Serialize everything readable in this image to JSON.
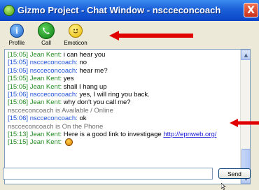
{
  "window": {
    "title": "Gizmo Project - Chat Window - nscceconcoach",
    "close_glyph": "X"
  },
  "toolbar": {
    "items": [
      {
        "label": "Profile",
        "icon": "info-icon",
        "glyph": "i"
      },
      {
        "label": "Call",
        "icon": "phone-icon"
      },
      {
        "label": "Emoticon",
        "icon": "smiley-icon"
      }
    ]
  },
  "chat": {
    "lines": [
      {
        "ts": "[15:05] Jean Kent:",
        "who": "jean",
        "msg": " i can hear you"
      },
      {
        "ts": "[15:05] nscceconcoach:",
        "who": "nsc",
        "msg": " no"
      },
      {
        "ts": "[15:05] nscceconcoach:",
        "who": "nsc",
        "msg": " hear me?"
      },
      {
        "ts": "[15:05] Jean Kent:",
        "who": "jean",
        "msg": " yes"
      },
      {
        "ts": "[15:05] Jean Kent:",
        "who": "jean",
        "msg": " shall I hang up"
      },
      {
        "ts": "[15:06] nscceconcoach:",
        "who": "nsc",
        "msg": " yes, I will ring you back."
      },
      {
        "ts": "[15:06] Jean Kent:",
        "who": "jean",
        "msg": " why don't you call me?"
      },
      {
        "status": "nscceconcoach is Available / Online"
      },
      {
        "ts": "[15:06] nscceconcoach:",
        "who": "nsc",
        "msg": " ok"
      },
      {
        "status": "nscceconcoach is On the Phone"
      },
      {
        "ts": "[15:13] Jean Kent:",
        "who": "jean",
        "msg": " Here is a good link to investigage ",
        "link": "http://epnweb.org/"
      },
      {
        "ts": "[15:15] Jean Kent:",
        "who": "jean",
        "msg": " ",
        "emoticon": "smiley-emoticon"
      }
    ]
  },
  "composer": {
    "input_value": "",
    "send_label": "Send"
  },
  "colors": {
    "titlebar": "#1c5fd8",
    "annotation_arrow": "#e00000",
    "jean_timestamp": "#228b22",
    "nsc_timestamp": "#1a4fd6",
    "status_text": "#6d6d6d",
    "link": "#1a1ad6"
  }
}
